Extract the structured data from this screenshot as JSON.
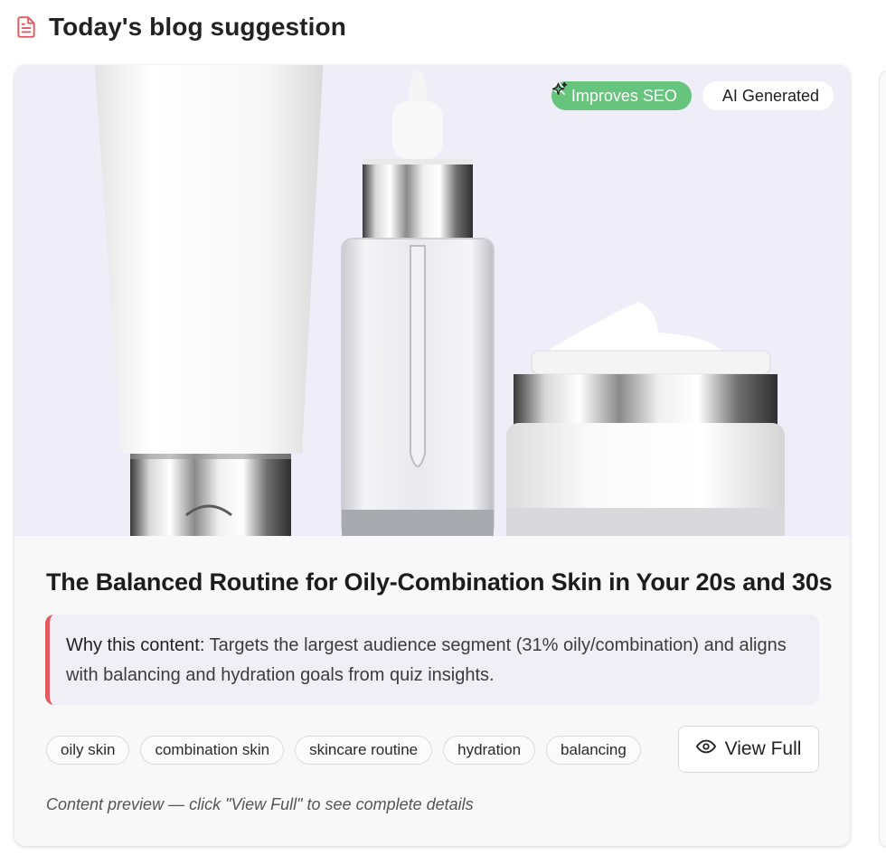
{
  "header": {
    "title": "Today's blog suggestion",
    "icon": "document-icon",
    "icon_color": "#e25a5f"
  },
  "hero": {
    "image": "skincare-products-illustration",
    "background": "#efeef8",
    "badges": [
      {
        "label": "Improves SEO",
        "icon": "search-icon",
        "color": "#67c47c"
      },
      {
        "label": "AI Generated",
        "icon": "sparkle-icon",
        "color": "#ffffff"
      }
    ]
  },
  "post": {
    "title": "The Balanced Routine for Oily-Combination Skin in Your 20s and 30s",
    "why_label": "Why this content:",
    "why_text": " Targets the largest audience segment (31% oily/combination) and aligns with balancing and hydration goals from quiz insights.",
    "accent_color": "#e25a5f",
    "tags": [
      "oily skin",
      "combination skin",
      "skincare routine",
      "hydration",
      "balancing"
    ],
    "view_button": {
      "label": "View Full",
      "icon": "eye-icon"
    },
    "preview_note": "Content preview — click \"View Full\" to see complete details"
  }
}
